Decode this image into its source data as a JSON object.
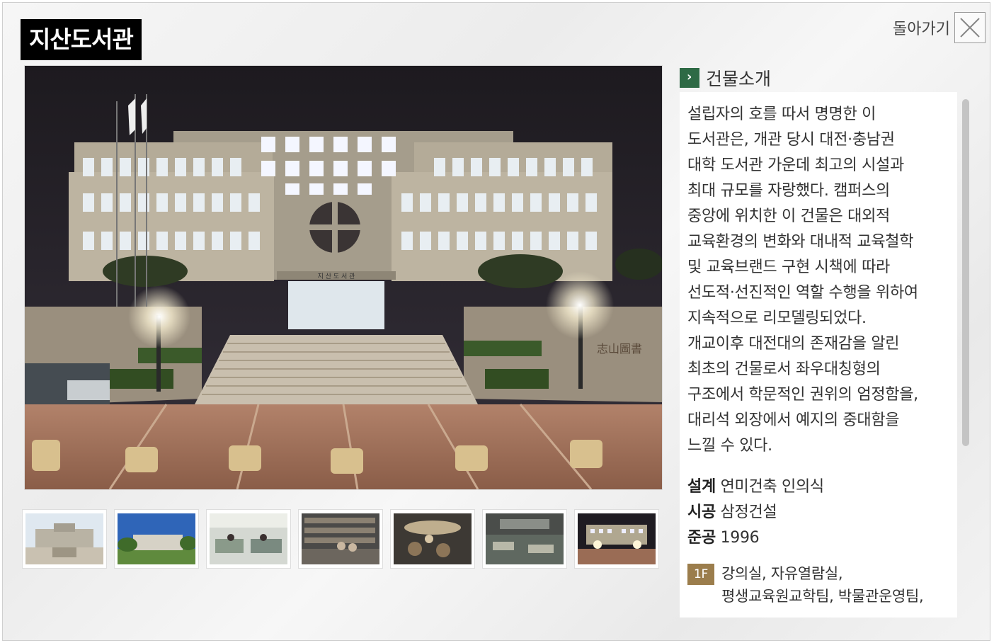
{
  "page": {
    "title": "지산도서관",
    "back_label": "돌아가기"
  },
  "photo": {
    "sign_text": "지 산 도 서 관",
    "stone_text": "志山圖書"
  },
  "thumbnails": [
    {
      "subject": "building-front-day"
    },
    {
      "subject": "building-side-day"
    },
    {
      "subject": "reading-room"
    },
    {
      "subject": "bookshelves"
    },
    {
      "subject": "lounge"
    },
    {
      "subject": "study-hall"
    },
    {
      "subject": "building-front-night"
    }
  ],
  "info": {
    "section_title": "건물소개",
    "description_lines": [
      "설립자의 호를 따서 명명한 이",
      "도서관은, 개관 당시 대전·충남권",
      "대학 도서관 가운데 최고의 시설과",
      "최대 규모를 자랑했다. 캠퍼스의",
      "중앙에 위치한 이 건물은 대외적",
      "교육환경의 변화와 대내적 교육철학",
      "및 교육브랜드 구현 시책에 따라",
      "선도적·선진적인 역할 수행을 위하여",
      "지속적으로 리모델링되었다.",
      "개교이후 대전대의 존재감을 알린",
      "최초의 건물로서 좌우대칭형의",
      "구조에서 학문적인 권위의 엄정함을,",
      "대리석 외장에서 예지의 중대함을",
      "느낄 수 있다."
    ],
    "specs": {
      "design_label": "설계",
      "design_value": "연미건축 인의식",
      "construction_label": "시공",
      "construction_value": "삼정건설",
      "completion_label": "준공",
      "completion_value": "1996"
    },
    "floors": [
      {
        "badge": "1F",
        "line1": "강의실, 자유열람실,",
        "line2": "평생교육원교학팀, 박물관운영팀,",
        "line3": "..."
      }
    ]
  },
  "colors": {
    "title_bg": "#000000",
    "section_bullet": "#2e6a45",
    "floor_badge": "#9b7d4c"
  },
  "icons": {
    "close": "close-x-icon",
    "bullet": "chevron-right-icon"
  }
}
